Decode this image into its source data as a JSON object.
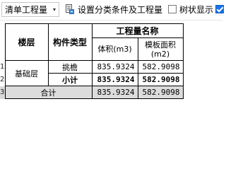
{
  "toolbar": {
    "quantity_dropdown": {
      "selected": "清单工程量",
      "arrow": "▾"
    },
    "setup_button_label": "设置分类条件及工程量",
    "tree_display_label": "树状显示"
  },
  "table": {
    "headers": {
      "floor": "楼层",
      "component_type": "构件类型",
      "quantity_name": "工程量名称",
      "volume": "体积(m3)",
      "formwork_area": "模板面积(m2)"
    },
    "row_numbers": [
      "1",
      "2",
      "3"
    ],
    "rows": [
      {
        "floor": "基础层",
        "component_type": "挑檐",
        "volume": "835.9324",
        "formwork_area": "582.9098"
      },
      {
        "component_type": "小计",
        "volume": "835.9324",
        "formwork_area": "582.9098"
      }
    ],
    "total": {
      "label": "合计",
      "volume": "835.9324",
      "formwork_area": "582.9098"
    }
  }
}
